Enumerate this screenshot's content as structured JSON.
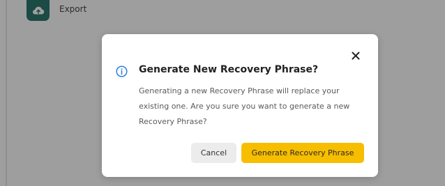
{
  "background": {
    "export_label": "Export",
    "export_icon": "cloud-upload-icon",
    "accent_color": "#1f6e66"
  },
  "dialog": {
    "info_icon": "info-icon",
    "close_icon": "close-icon",
    "title": "Generate New Recovery Phrase?",
    "message": "Generating a new Recovery Phrase will replace your existing one. Are you sure you want to generate a new Recovery Phrase?",
    "cancel_label": "Cancel",
    "confirm_label": "Generate Recovery Phrase",
    "confirm_color": "#f7be00",
    "info_color": "#2b7fe0"
  }
}
